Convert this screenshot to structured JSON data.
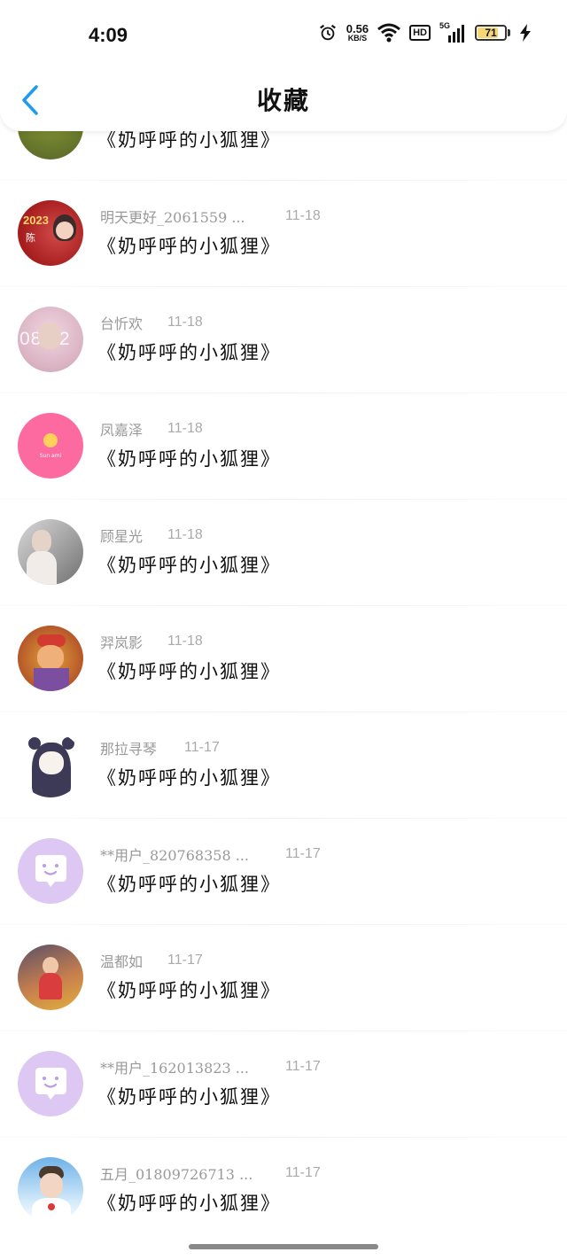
{
  "status": {
    "time": "4:09",
    "speed_value": "0.56",
    "speed_unit": "KB/S",
    "hd": "HD",
    "net": "5G",
    "battery": "71",
    "battery_level": 0.71
  },
  "header": {
    "title": "收藏",
    "accent": "#1e9bf0"
  },
  "items": [
    {
      "name": "",
      "date": "",
      "content": "《奶呼呼的小狐狸》",
      "avatar": "photo-green"
    },
    {
      "name": "明天更好_2061559 ...",
      "date": "11-18",
      "content": "《奶呼呼的小狐狸》",
      "avatar": "photo-red-2023",
      "avatar_text": "2023",
      "avatar_text2": "陈"
    },
    {
      "name": "台忻欢",
      "date": "11-18",
      "content": "《奶呼呼的小狐狸》",
      "avatar": "photo-pink",
      "avatar_text": "08:02"
    },
    {
      "name": "凤嘉泽",
      "date": "11-18",
      "content": "《奶呼呼的小狐狸》",
      "avatar": "pink-sun",
      "avatar_text": "Sun ami"
    },
    {
      "name": "顾星光",
      "date": "11-18",
      "content": "《奶呼呼的小狐狸》",
      "avatar": "photo-gray"
    },
    {
      "name": "羿岚影",
      "date": "11-18",
      "content": "《奶呼呼的小狐狸》",
      "avatar": "photo-cartoon"
    },
    {
      "name": "那拉寻琴",
      "date": "11-17",
      "content": "《奶呼呼的小狐狸》",
      "avatar": "anime-bear"
    },
    {
      "name": "**用户_820768358 ...",
      "date": "11-17",
      "content": "《奶呼呼的小狐狸》",
      "avatar": "default-chat"
    },
    {
      "name": "温都如",
      "date": "11-17",
      "content": "《奶呼呼的小狐狸》",
      "avatar": "photo-girl"
    },
    {
      "name": "**用户_162013823 ...",
      "date": "11-17",
      "content": "《奶呼呼的小狐狸》",
      "avatar": "default-chat"
    },
    {
      "name": "五月_01809726713 ...",
      "date": "11-17",
      "content": "《奶呼呼的小狐狸》",
      "avatar": "photo-boy"
    }
  ]
}
